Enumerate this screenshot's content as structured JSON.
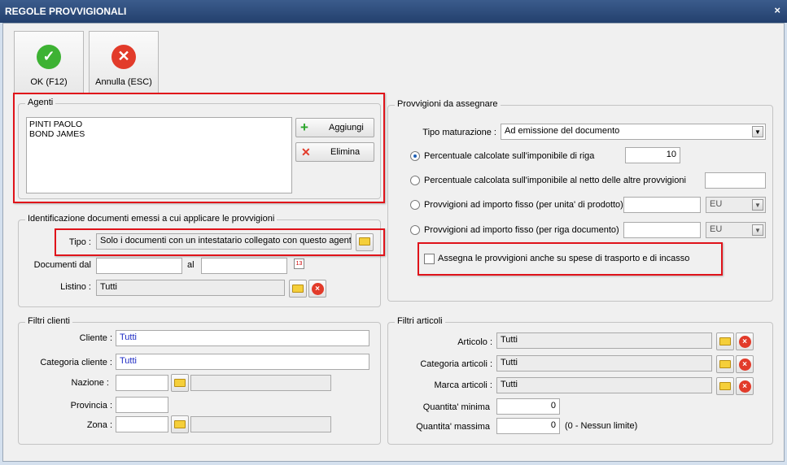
{
  "window": {
    "title": "REGOLE PROVVIGIONALI",
    "close_glyph": "×"
  },
  "toolbar": {
    "ok": {
      "label": "OK (F12)",
      "icon": "check-icon",
      "color": "#3db233"
    },
    "cancel": {
      "label": "Annulla (ESC)",
      "icon": "close-icon",
      "color": "#e23b2a"
    }
  },
  "agenti": {
    "legend": "Agenti",
    "items": [
      "PINTI PAOLO",
      "BOND JAMES"
    ],
    "add_label": "Aggiungi",
    "remove_label": "Elimina"
  },
  "identificazione": {
    "legend": "Identificazione documenti emessi a cui applicare le provvigioni",
    "tipo_label": "Tipo :",
    "tipo_value": "Solo i documenti con un intestatario collegato con questo agente",
    "documenti_dal_label": "Documenti dal",
    "documenti_dal_value": "",
    "al_label": "al",
    "al_value": "",
    "listino_label": "Listino :",
    "listino_value": "Tutti"
  },
  "provvigioni": {
    "legend": "Provvigioni da assegnare",
    "tipo_maturazione_label": "Tipo maturazione :",
    "tipo_maturazione_value": "Ad emissione del documento",
    "opt1_label": "Percentuale calcolate sull'imponibile di riga",
    "opt1_value": "10",
    "opt2_label": "Percentuale calcolata sull'imponibile al netto delle altre provvigioni",
    "opt2_value": "",
    "opt3_label": "Provvigioni ad importo fisso (per unita' di prodotto)",
    "opt3_value": "",
    "opt3_currency": "EU",
    "opt4_label": "Provvigioni ad importo fisso (per riga documento)",
    "opt4_value": "",
    "opt4_currency": "EU",
    "assegna_label": "Assegna le provvigioni anche su spese di trasporto e di incasso"
  },
  "filtri_clienti": {
    "legend": "Filtri clienti",
    "cliente_label": "Cliente :",
    "cliente_value": "Tutti",
    "categoria_label": "Categoria cliente :",
    "categoria_value": "Tutti",
    "nazione_label": "Nazione :",
    "nazione_code": "",
    "nazione_desc": "",
    "provincia_label": "Provincia :",
    "provincia_value": "",
    "zona_label": "Zona :",
    "zona_code": "",
    "zona_desc": ""
  },
  "filtri_articoli": {
    "legend": "Filtri articoli",
    "articolo_label": "Articolo :",
    "articolo_value": "Tutti",
    "categoria_label": "Categoria articoli :",
    "categoria_value": "Tutti",
    "marca_label": "Marca articoli :",
    "marca_value": "Tutti",
    "qmin_label": "Quantita' minima",
    "qmin_value": "0",
    "qmax_label": "Quantita' massima",
    "qmax_value": "0",
    "qmax_hint": "(0 - Nessun limite)"
  },
  "icons": {
    "folder": "folder-icon",
    "delete": "delete-icon",
    "calendar": "calendar-icon",
    "add": "plus-icon",
    "remove": "x-icon"
  },
  "colors": {
    "highlight_border": "#e0131a",
    "titlebar": "#2b4a7a",
    "link_text": "#1f2cc4"
  }
}
